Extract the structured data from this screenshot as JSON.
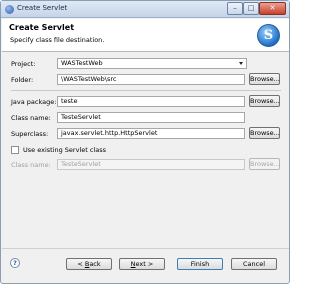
{
  "window": {
    "title": "Create Servlet",
    "min_glyph": "–",
    "max_glyph": "□",
    "close_glyph": "✕"
  },
  "header": {
    "title": "Create Servlet",
    "subtitle": "Specify class file destination.",
    "logo_letter": "S"
  },
  "form": {
    "project_label": "Project:",
    "project_value": "WASTestWeb",
    "folder_label": "Folder:",
    "folder_value": "\\WASTestWeb\\src",
    "java_package_label": "Java package:",
    "java_package_value": "teste",
    "class_name_label": "Class name:",
    "class_name_value": "TesteServlet",
    "superclass_label": "Superclass:",
    "superclass_value": "javax.servlet.http.HttpServlet",
    "use_existing_label": "Use existing Servlet class",
    "existing_class_label": "Class name:",
    "existing_class_value": "TesteServlet",
    "browse_label": "Browse..."
  },
  "footer": {
    "help_glyph": "?",
    "back_prefix": "< ",
    "back_key": "B",
    "back_rest": "ack",
    "next_key": "N",
    "next_rest": "ext >",
    "finish_label": "Finish",
    "cancel_label": "Cancel"
  },
  "colors": {
    "title_gradient_top": "#dfe9f5",
    "close_red": "#c7402a",
    "logo_blue": "#1f6fc7"
  }
}
